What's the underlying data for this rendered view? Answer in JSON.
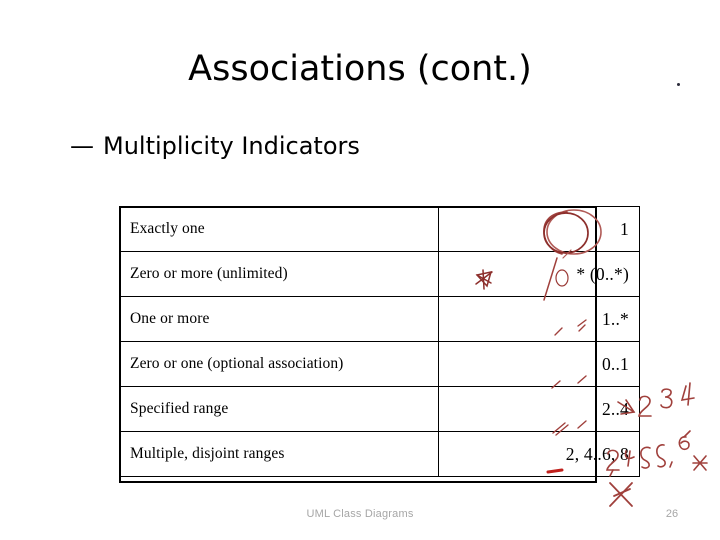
{
  "slide": {
    "title": "Associations (cont.)",
    "bullet": {
      "marker": "—",
      "text": "Multiplicity Indicators"
    },
    "footer": "UML Class Diagrams",
    "page_number": "26"
  },
  "table": {
    "columns": [
      "description",
      "notation"
    ],
    "rows": [
      {
        "description": "Exactly one",
        "notation": "1"
      },
      {
        "description": "Zero or more (unlimited)",
        "notation": "*  (0..*)"
      },
      {
        "description": "One or more",
        "notation": "1..*"
      },
      {
        "description": "Zero or one (optional association)",
        "notation": "0..1"
      },
      {
        "description": "Specified range",
        "notation": "2..4"
      },
      {
        "description": "Multiple, disjoint ranges",
        "notation": "2, 4..6, 8"
      }
    ]
  },
  "annotations": {
    "ink_color": "#a52a2a",
    "ink_color_light": "#c0504d",
    "margin_notes": [
      {
        "text": "2 3 4"
      },
      {
        "text": "2, 4 5 6, 8"
      }
    ],
    "marks": [
      {
        "name": "circle-around-exactly-one",
        "shape": "ellipse"
      },
      {
        "name": "circle-around-exactly-one-2",
        "shape": "ellipse"
      },
      {
        "name": "star-scribble",
        "shape": "asterisk"
      },
      {
        "name": "slash-through-zero-or-more",
        "shape": "stroke"
      },
      {
        "name": "underline-one-or-more",
        "shape": "tick"
      },
      {
        "name": "underline-zero-or-one",
        "shape": "tick"
      },
      {
        "name": "underline-specified-range",
        "shape": "tick"
      },
      {
        "name": "underline-disjoint-ranges",
        "shape": "bar"
      },
      {
        "name": "cross-out-mark",
        "shape": "x"
      },
      {
        "name": "asterisk-margin",
        "shape": "asterisk"
      }
    ]
  },
  "colors": {
    "background": "#ffffff",
    "text": "#000000",
    "footer_text": "#a6a6a6",
    "table_border": "#000000",
    "ink": "#a52a2a"
  }
}
